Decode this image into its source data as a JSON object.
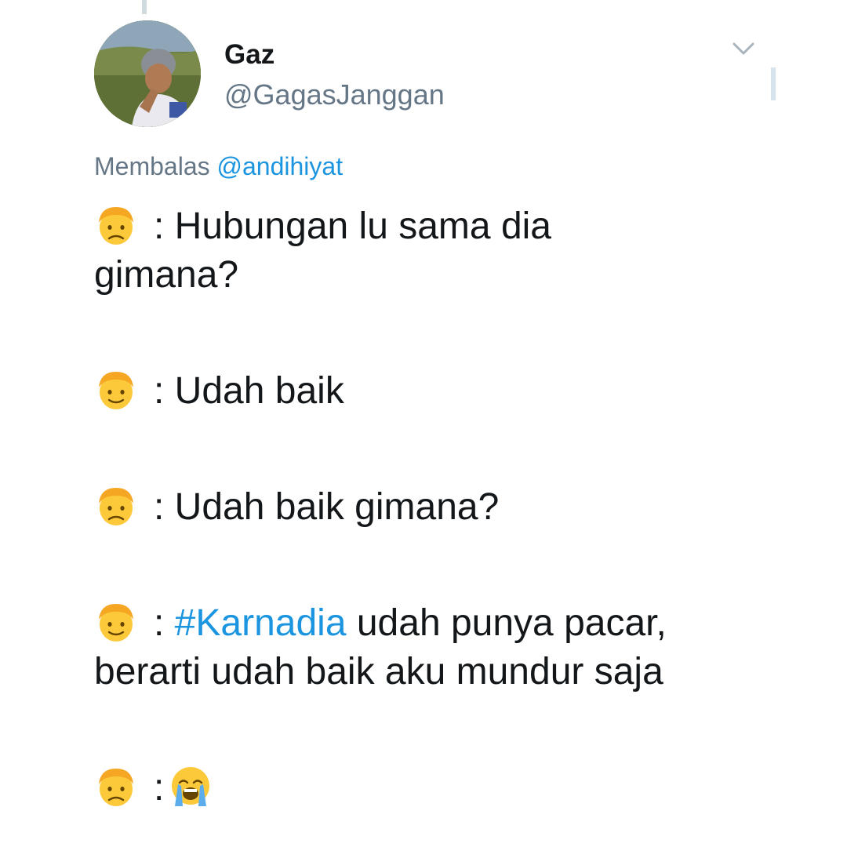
{
  "tweet": {
    "display_name": "Gaz",
    "handle": "@GagasJanggan",
    "reply_prefix": "Membalas ",
    "reply_to": "@andihiyat",
    "lines": {
      "l1_text": ": Hubungan lu sama dia",
      "l1_cont": "gimana?",
      "l2_text": ": Udah baik",
      "l3_text": ": Udah baik gimana?",
      "l4_colon": ": ",
      "l4_hashtag": "#Karnadia",
      "l4_text": " udah punya pacar,",
      "l4_cont": "berarti udah baik aku mundur saja",
      "l5_colon": ":"
    }
  },
  "icons": {
    "speaker_a": "frowning-blond-man-icon",
    "speaker_b": "smiling-blond-man-icon",
    "reaction": "loudly-crying-face-icon",
    "menu": "chevron-down-icon"
  },
  "colors": {
    "link": "#1b95e0",
    "secondary_text": "#657786",
    "primary_text": "#14171a"
  }
}
